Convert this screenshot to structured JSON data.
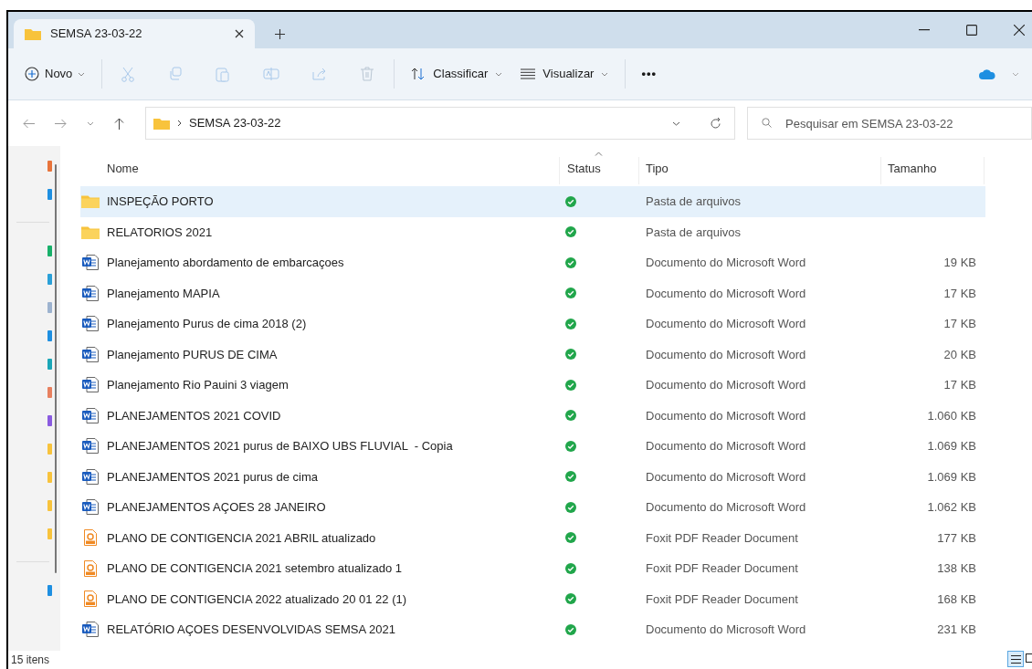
{
  "window": {
    "tab_title": "SEMSA 23-03-22"
  },
  "toolbar": {
    "new": "Novo",
    "sort": "Classificar",
    "view": "Visualizar",
    "more": "•••"
  },
  "address": {
    "crumb": "SEMSA 23-03-22",
    "search_placeholder": "Pesquisar em SEMSA 23-03-22"
  },
  "columns": [
    "Nome",
    "Status",
    "Tipo",
    "Tamanho"
  ],
  "rows": [
    {
      "kind": "folder",
      "name": "INSPEÇÃO PORTO",
      "type": "Pasta de arquivos",
      "size": "",
      "selected": true
    },
    {
      "kind": "folder",
      "name": "RELATORIOS 2021",
      "type": "Pasta de arquivos",
      "size": "",
      "selected": false
    },
    {
      "kind": "word",
      "name": "Planejamento abordamento de embarcaçoes",
      "type": "Documento do Microsoft Word",
      "size": "19 KB",
      "selected": false
    },
    {
      "kind": "word",
      "name": "Planejamento MAPIA",
      "type": "Documento do Microsoft Word",
      "size": "17 KB",
      "selected": false
    },
    {
      "kind": "word",
      "name": "Planejamento Purus de cima 2018 (2)",
      "type": "Documento do Microsoft Word",
      "size": "17 KB",
      "selected": false
    },
    {
      "kind": "word",
      "name": "Planejamento PURUS DE CIMA",
      "type": "Documento do Microsoft Word",
      "size": "20 KB",
      "selected": false
    },
    {
      "kind": "word",
      "name": "Planejamento Rio Pauini 3 viagem",
      "type": "Documento do Microsoft Word",
      "size": "17 KB",
      "selected": false
    },
    {
      "kind": "word",
      "name": "PLANEJAMENTOS 2021 COVID",
      "type": "Documento do Microsoft Word",
      "size": "1.060 KB",
      "selected": false
    },
    {
      "kind": "word",
      "name": "PLANEJAMENTOS 2021 purus de BAIXO UBS FLUVIAL  - Copia",
      "type": "Documento do Microsoft Word",
      "size": "1.069 KB",
      "selected": false
    },
    {
      "kind": "word",
      "name": "PLANEJAMENTOS 2021 purus de cima",
      "type": "Documento do Microsoft Word",
      "size": "1.069 KB",
      "selected": false
    },
    {
      "kind": "word",
      "name": "PLANEJAMENTOS AÇOES 28 JANEIRO",
      "type": "Documento do Microsoft Word",
      "size": "1.062 KB",
      "selected": false
    },
    {
      "kind": "pdf",
      "name": "PLANO DE CONTIGENCIA 2021 ABRIL atualizado",
      "type": "Foxit PDF Reader Document",
      "size": "177 KB",
      "selected": false
    },
    {
      "kind": "pdf",
      "name": "PLANO DE CONTIGENCIA 2021 setembro atualizado 1",
      "type": "Foxit PDF Reader Document",
      "size": "138 KB",
      "selected": false
    },
    {
      "kind": "pdf",
      "name": "PLANO DE CONTIGENCIA 2022 atualizado 20 01 22 (1)",
      "type": "Foxit PDF Reader Document",
      "size": "168 KB",
      "selected": false
    },
    {
      "kind": "word",
      "name": "RELATÓRIO AÇOES DESENVOLVIDAS SEMSA 2021",
      "type": "Documento do Microsoft Word",
      "size": "231 KB",
      "selected": false
    }
  ],
  "status_bar": {
    "count": "15 itens"
  }
}
